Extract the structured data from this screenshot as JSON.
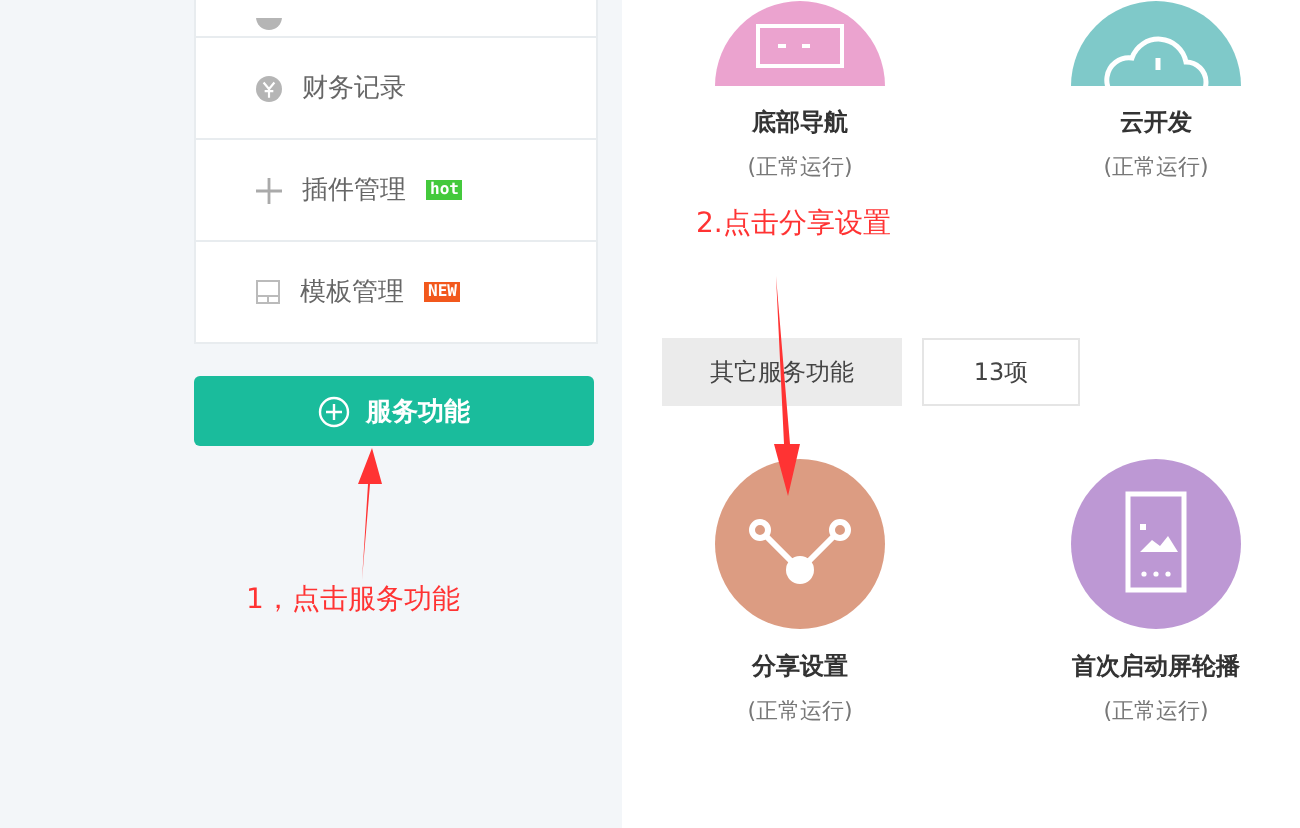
{
  "sidebar": {
    "items": [
      {
        "kind": "coin",
        "label": "财务记录"
      },
      {
        "kind": "plus",
        "label": "插件管理",
        "badge": {
          "text": "hot",
          "color": "#44c93c"
        }
      },
      {
        "kind": "template",
        "label": "模板管理",
        "badge": {
          "text": "NEW",
          "color": "#f2581c"
        }
      }
    ],
    "service_button": "服务功能"
  },
  "top_tiles": [
    {
      "kind": "grid",
      "name": "底部导航",
      "status": "(正常运行)",
      "color": "#eba3cf"
    },
    {
      "kind": "cloud",
      "name": "云开发",
      "status": "(正常运行)",
      "color": "#7fc9c9"
    }
  ],
  "section": {
    "title": "其它服务功能",
    "count": "13项"
  },
  "tiles": [
    {
      "kind": "share",
      "name": "分享设置",
      "status": "(正常运行)",
      "color": "#dc9c82"
    },
    {
      "kind": "phone",
      "name": "首次启动屏轮播",
      "status": "(正常运行)",
      "color": "#bd98d4"
    }
  ],
  "annotations": [
    {
      "text": "1，点击服务功能"
    },
    {
      "text": "2.点击分享设置"
    }
  ]
}
